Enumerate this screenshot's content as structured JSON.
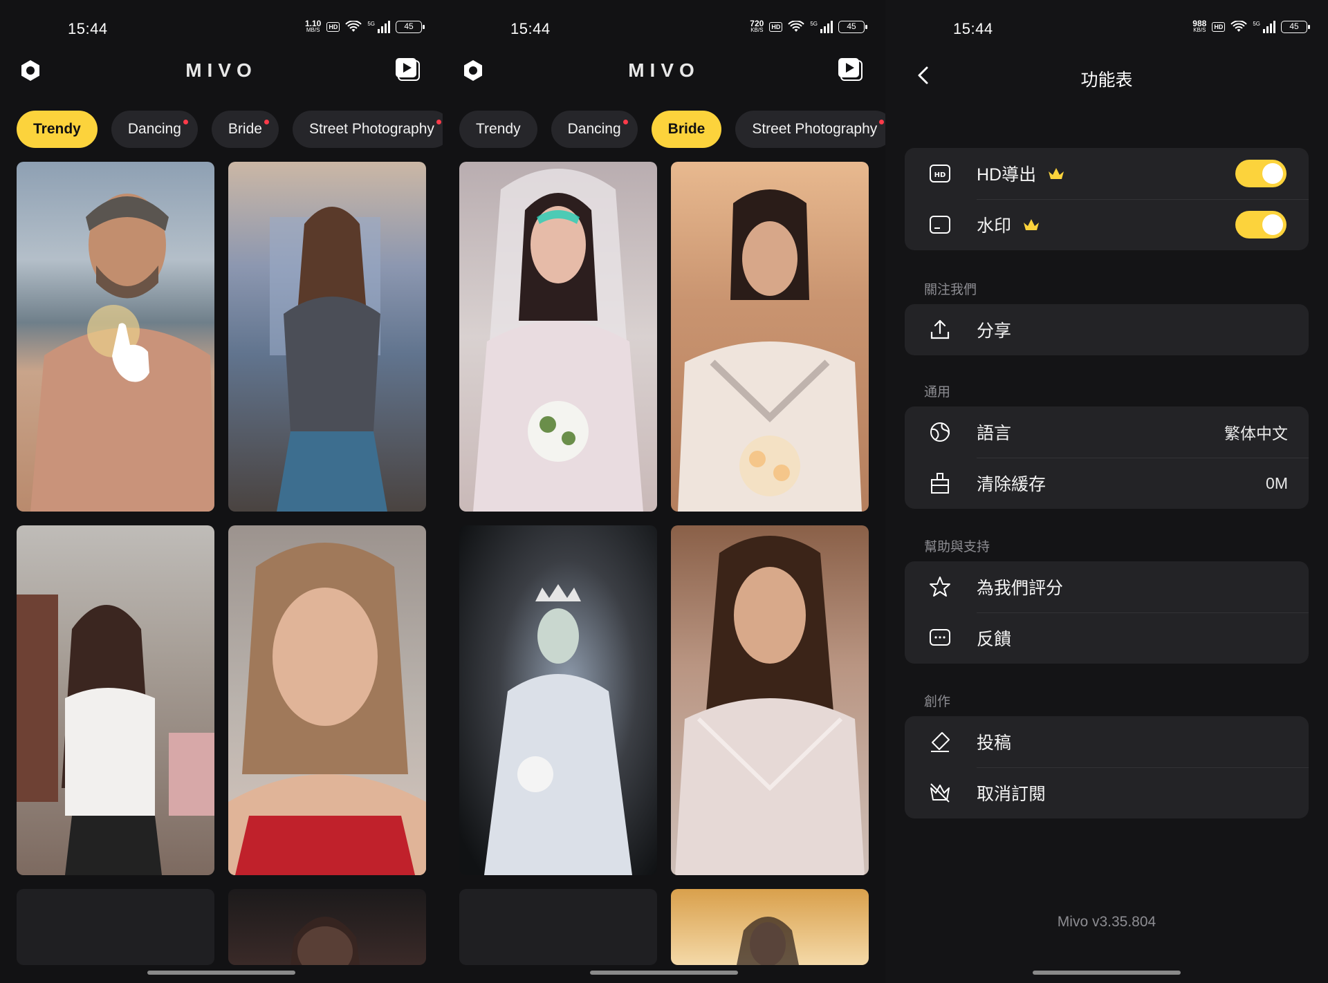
{
  "status_bars": [
    {
      "time": "15:44",
      "net_speed": "1.10",
      "net_unit": "MB/S",
      "hd": "HD",
      "signal": "5G",
      "battery": "45"
    },
    {
      "time": "15:44",
      "net_speed": "720",
      "net_unit": "KB/S",
      "hd": "HD",
      "signal": "5G",
      "battery": "45"
    },
    {
      "time": "15:44",
      "net_speed": "988",
      "net_unit": "KB/S",
      "hd": "HD",
      "signal": "5G",
      "battery": "45"
    }
  ],
  "app": {
    "brand": "MIVO"
  },
  "feeds": [
    {
      "tabs": [
        {
          "label": "Trendy",
          "active": true,
          "dot": false
        },
        {
          "label": "Dancing",
          "active": false,
          "dot": true
        },
        {
          "label": "Bride",
          "active": false,
          "dot": true
        },
        {
          "label": "Street Photography",
          "active": false,
          "dot": true
        }
      ]
    },
    {
      "tabs": [
        {
          "label": "Trendy",
          "active": false,
          "dot": false
        },
        {
          "label": "Dancing",
          "active": false,
          "dot": true
        },
        {
          "label": "Bride",
          "active": true,
          "dot": false
        },
        {
          "label": "Street Photography",
          "active": false,
          "dot": true
        }
      ]
    }
  ],
  "settings": {
    "title": "功能表",
    "export_group": {
      "hd_label": "HD導出",
      "hd_on": true,
      "watermark_label": "水印",
      "watermark_on": true
    },
    "follow_section": "關注我們",
    "share_label": "分享",
    "general_section": "通用",
    "language_label": "語言",
    "language_value": "繁体中文",
    "cache_label": "清除緩存",
    "cache_value": "0M",
    "help_section": "幫助與支持",
    "rate_label": "為我們評分",
    "feedback_label": "反饋",
    "create_section": "創作",
    "submit_label": "投稿",
    "unsubscribe_label": "取消訂閱",
    "version": "Mivo v3.35.804"
  },
  "colors": {
    "accent": "#fcd33c",
    "background": "#121214",
    "card": "#232326",
    "badge_dot": "#ff3b4a"
  }
}
